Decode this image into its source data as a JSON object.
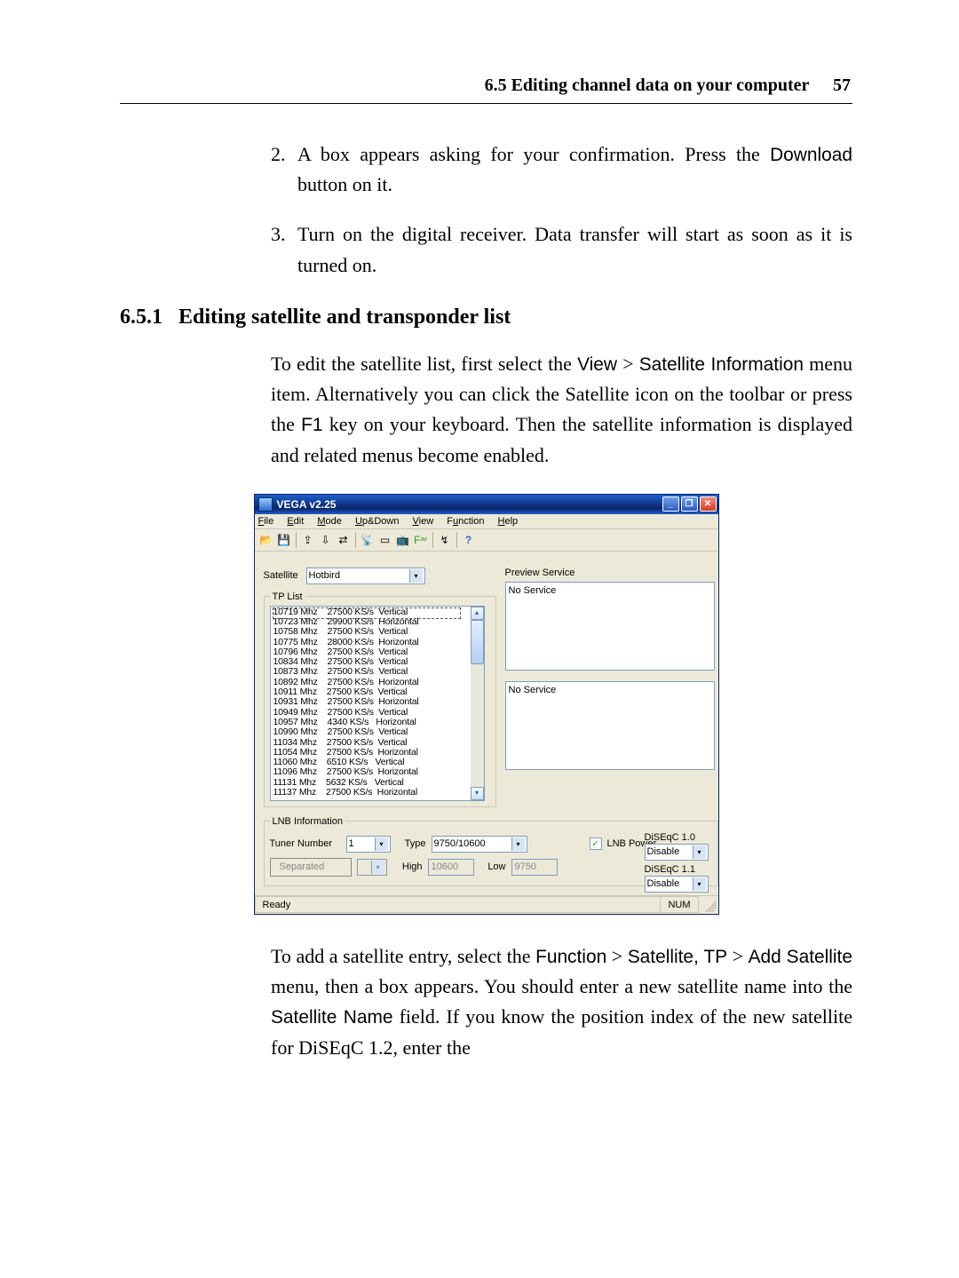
{
  "running_head": {
    "title": "6.5 Editing channel data on your computer",
    "page": "57"
  },
  "steps": {
    "item2_a": "A box appears asking for your confirmation. Press the ",
    "item2_btn": "Download",
    "item2_b": " button on it.",
    "item3": "Turn on the digital receiver. Data transfer will start as soon as it is turned on."
  },
  "section": {
    "num": "6.5.1",
    "title": "Editing satellite and transponder list"
  },
  "para1": {
    "a": "To edit the satellite list, first select the ",
    "view": "View",
    "gt1": " > ",
    "satinfo": "Satellite Information",
    "b": " menu item. Alternatively you can click the Satellite icon on the toolbar or press the ",
    "f1": "F1",
    "c": " key on your keyboard. Then the satellite information is displayed and related menus become enabled."
  },
  "para2": {
    "a": "To add a satellite entry, select the ",
    "fn": "Function",
    "gt1": " > ",
    "sat": "Satellite, TP",
    "gt2": " > ",
    "add": "Add Satellite",
    "b": " menu, then a box appears. You should enter a new satellite name into the ",
    "field": "Satellite Name",
    "c": " field. If you know the position index of the new satellite for DiSEqC 1.2, enter the"
  },
  "app": {
    "title": "VEGA v2.25",
    "menu": [
      "File",
      "Edit",
      "Mode",
      "Up&Down",
      "View",
      "Function",
      "Help"
    ],
    "sat_label": "Satellite",
    "sat_value": "Hotbird",
    "tp_legend": "TP List",
    "preview_label": "Preview Service",
    "no_service": "No Service",
    "lnb_legend": "LNB Information",
    "tuner_label": "Tuner Number",
    "tuner_value": "1",
    "type_label": "Type",
    "type_value": "9750/10600",
    "lnbpower_label": "LNB Power",
    "separated_label": "Separated",
    "high_label": "High",
    "high_value": "10600",
    "low_label": "Low",
    "low_value": "9750",
    "diseqc10_label": "DiSEqC 1.0",
    "diseqc11_label": "DiSEqC 1.1",
    "disable": "Disable",
    "status_ready": "Ready",
    "status_num": "NUM",
    "tp_rows": [
      {
        "f": "10719 Mhz",
        "s": "27500 KS/s",
        "p": "Vertical"
      },
      {
        "f": "10723 Mhz",
        "s": "29900 KS/s",
        "p": "Horizontal"
      },
      {
        "f": "10758 Mhz",
        "s": "27500 KS/s",
        "p": "Vertical"
      },
      {
        "f": "10775 Mhz",
        "s": "28000 KS/s",
        "p": "Horizontal"
      },
      {
        "f": "10796 Mhz",
        "s": "27500 KS/s",
        "p": "Vertical"
      },
      {
        "f": "10834 Mhz",
        "s": "27500 KS/s",
        "p": "Vertical"
      },
      {
        "f": "10873 Mhz",
        "s": "27500 KS/s",
        "p": "Vertical"
      },
      {
        "f": "10892 Mhz",
        "s": "27500 KS/s",
        "p": "Horizontal"
      },
      {
        "f": "10911 Mhz",
        "s": "27500 KS/s",
        "p": "Vertical"
      },
      {
        "f": "10931 Mhz",
        "s": "27500 KS/s",
        "p": "Horizontal"
      },
      {
        "f": "10949 Mhz",
        "s": "27500 KS/s",
        "p": "Vertical"
      },
      {
        "f": "10957 Mhz",
        "s": "4340 KS/s",
        "p": "Horizontal"
      },
      {
        "f": "10990 Mhz",
        "s": "27500 KS/s",
        "p": "Vertical"
      },
      {
        "f": "11034 Mhz",
        "s": "27500 KS/s",
        "p": "Vertical"
      },
      {
        "f": "11054 Mhz",
        "s": "27500 KS/s",
        "p": "Horizontal"
      },
      {
        "f": "11060 Mhz",
        "s": "6510 KS/s",
        "p": "Vertical"
      },
      {
        "f": "11096 Mhz",
        "s": "27500 KS/s",
        "p": "Horizontal"
      },
      {
        "f": "11131 Mhz",
        "s": "5632 KS/s",
        "p": "Vertical"
      },
      {
        "f": "11137 Mhz",
        "s": "27500 KS/s",
        "p": "Horizontal"
      }
    ]
  }
}
